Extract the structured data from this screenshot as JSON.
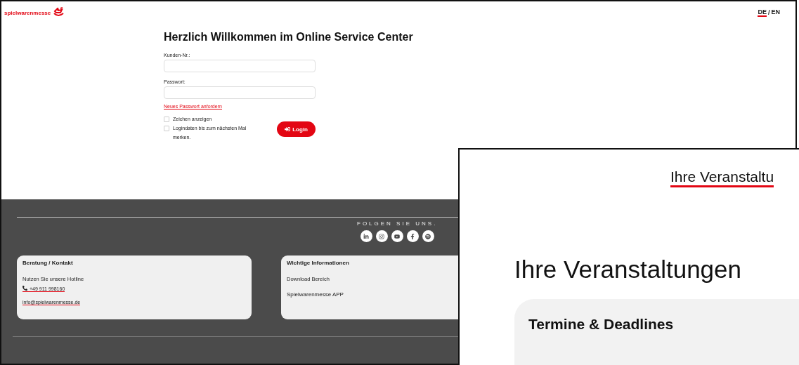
{
  "back_window": {
    "logo": "spielwarenmesse",
    "languages": [
      {
        "label": "DE",
        "selected": true
      },
      {
        "label": "EN",
        "selected": false
      }
    ],
    "separator": "/",
    "title": "Herzlich Willkommen im Online Service Center",
    "fields": [
      {
        "label": "Kunden-Nr.:"
      },
      {
        "label": "Passwort:"
      }
    ],
    "link": "Neues Passwort anfordern",
    "checkboxes": [
      {
        "label": "Zeichen anzeigen",
        "checked": false
      },
      {
        "label": "Logindaten bis zum nächsten Mal merken.",
        "checked": false
      }
    ],
    "login_button": "Login",
    "footer": {
      "follow": "FOLGEN SIE UNS.",
      "cards": [
        {
          "title": "Beratung / Kontakt",
          "lines": [
            {
              "kind": "text",
              "text": "Nutzen Sie unsere Hotline"
            },
            {
              "kind": "phone",
              "text": "+49 911 998160"
            },
            {
              "kind": "email",
              "text": "info@spielwarenmesse.de"
            }
          ]
        },
        {
          "title": "Wichtige Informationen",
          "lines": [
            {
              "kind": "text",
              "text": "Download Bereich"
            },
            {
              "kind": "item",
              "text": "Spielwarenmesse APP"
            }
          ]
        }
      ]
    }
  },
  "front_window": {
    "nav_link": "Ihre Veranstaltu",
    "heading": "Ihre Veranstaltungen",
    "card_title": "Termine & Deadlines"
  }
}
